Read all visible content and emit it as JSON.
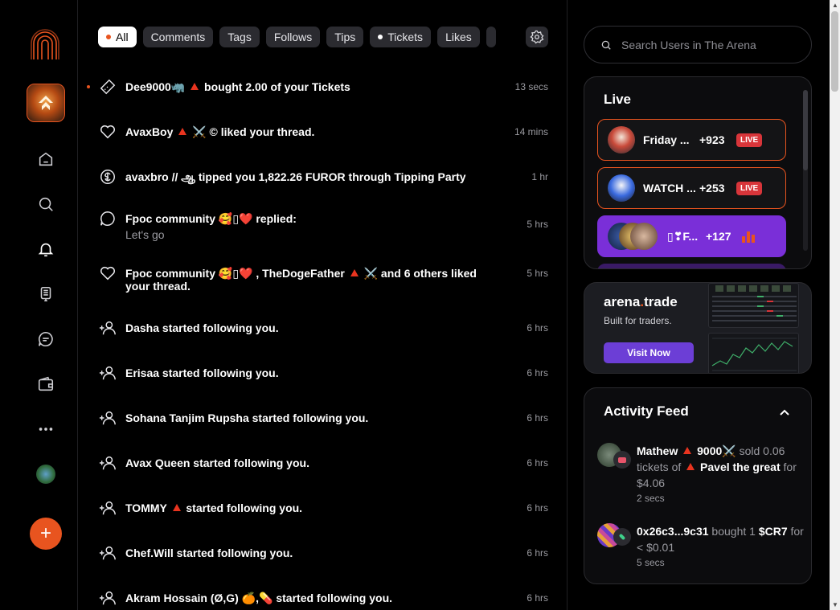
{
  "sidebar": {
    "icons": [
      "home-icon",
      "search-icon",
      "bell-icon",
      "document-icon",
      "chat-icon",
      "wallet-icon",
      "more-icon"
    ],
    "fab_label": "+"
  },
  "filters": {
    "chips": [
      "All",
      "Comments",
      "Tags",
      "Follows",
      "Tips",
      "Tickets",
      "Likes"
    ],
    "active": "All"
  },
  "notifications": [
    {
      "icon": "ticket-icon",
      "text": "Dee9000🦏 ▲ bought 2.00 of your Tickets",
      "time": "13 secs",
      "unread": true
    },
    {
      "icon": "heart-icon",
      "text": "AvaxBoy ▲ ⚔️ © liked your thread.",
      "time": "14 mins"
    },
    {
      "icon": "dollar-icon",
      "text": "avaxbro // ஆ tipped you 1,822.26 FUROR through Tipping Party",
      "time": "1 hr"
    },
    {
      "icon": "reply-icon",
      "text": "Fpoc community 🥰▯❤️ replied:",
      "sub": "Let's go",
      "time": "5 hrs"
    },
    {
      "icon": "heart-icon",
      "text": "Fpoc community 🥰▯❤️ , TheDogeFather ▲ ⚔️ and 6 others liked your thread.",
      "time": "5 hrs"
    },
    {
      "icon": "user-plus-icon",
      "text": "Dasha started following you.",
      "time": "6 hrs"
    },
    {
      "icon": "user-plus-icon",
      "text": "Erisaa started following you.",
      "time": "6 hrs"
    },
    {
      "icon": "user-plus-icon",
      "text": "Sohana Tanjim Rupsha started following you.",
      "time": "6 hrs"
    },
    {
      "icon": "user-plus-icon",
      "text": "Avax Queen started following you.",
      "time": "6 hrs"
    },
    {
      "icon": "user-plus-icon",
      "text": "TOMMY ▲ started following you.",
      "time": "6 hrs"
    },
    {
      "icon": "user-plus-icon",
      "text": "Chef.Will started following you.",
      "time": "6 hrs"
    },
    {
      "icon": "user-plus-icon",
      "text": "Akram Hossain (Ø,G) 🍊,💊 started following you.",
      "time": "6 hrs"
    }
  ],
  "search": {
    "placeholder": "Search Users in The Arena"
  },
  "live": {
    "title": "Live",
    "items": [
      {
        "name": "Friday ...",
        "count": "+923",
        "badge": "LIVE"
      },
      {
        "name": "WATCH ...",
        "count": "+253",
        "badge": "LIVE"
      },
      {
        "name": "▯❣F...",
        "count": "+127",
        "badge": "bars-icon"
      }
    ]
  },
  "trade": {
    "brand_prefix": "arena",
    "brand_dot": ".",
    "brand_suffix": "trade",
    "subtitle": "Built for traders.",
    "button": "Visit Now"
  },
  "activity": {
    "title": "Activity Feed",
    "items": [
      {
        "user": "Mathew ▲ 9000⚔️",
        "action": "sold 0.06 tickets of",
        "target": "▲ Pavel the great",
        "price": "for $4.06",
        "time": "2 secs"
      },
      {
        "user": "0x26c3...9c31",
        "action": "bought 1",
        "target": "$CR7",
        "price": "for < $0.01",
        "time": "5 secs"
      }
    ]
  },
  "colors": {
    "accent": "#e8541f",
    "live_badge": "#d8353a",
    "purple": "#7a2fd8",
    "button_purple": "#6c3ed6"
  }
}
